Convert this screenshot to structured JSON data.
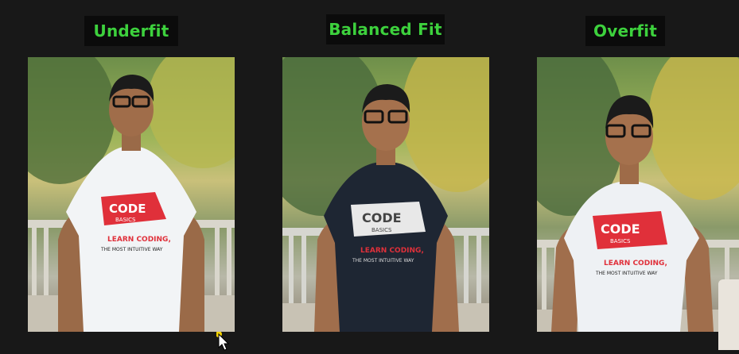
{
  "panels": [
    {
      "label": "Underfit",
      "shirt_color": "#f2f4f6",
      "logo_text": "CODE",
      "logo_sub": "BASICS",
      "slogan1": "LEARN CODING,",
      "slogan2": "THE MOST INTUITIVE WAY"
    },
    {
      "label": "Balanced Fit",
      "shirt_color": "#1e2633",
      "logo_text": "CODE",
      "logo_sub": "BASICS",
      "slogan1": "LEARN CODING,",
      "slogan2": "THE MOST INTUITIVE WAY"
    },
    {
      "label": "Overfit",
      "shirt_color": "#eef1f4",
      "logo_text": "CODE",
      "logo_sub": "BASICS",
      "slogan1": "LEARN CODING,",
      "slogan2": "THE MOST INTUITIVE WAY"
    }
  ],
  "colors": {
    "label_text": "#3dd13d",
    "label_bg": "#0b0b0b",
    "background": "#181818",
    "brand_red": "#e0303a"
  }
}
